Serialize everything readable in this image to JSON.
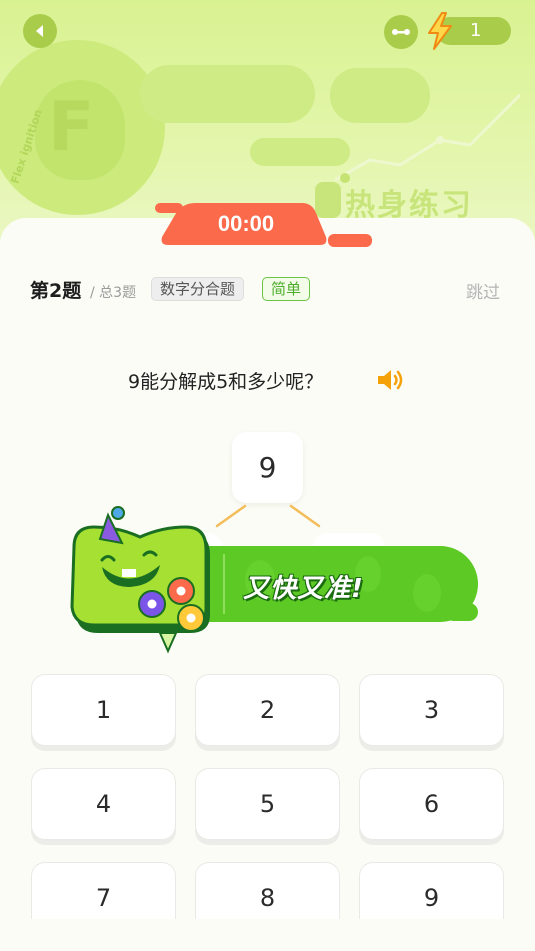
{
  "header": {
    "energy_count": "1",
    "banner_watermark": "Flex ignition",
    "logo_letter": "F",
    "watermark_title": "热身练习"
  },
  "timer": {
    "value": "00:00"
  },
  "question_meta": {
    "number": "第2题",
    "total": "/ 总3题",
    "type_tag": "数字分合题",
    "difficulty_tag": "简单",
    "skip_label": "跳过"
  },
  "question": {
    "text": "9能分解成5和多少呢？"
  },
  "tree": {
    "top_value": "9"
  },
  "feedback": {
    "banner_text": "又快又准!"
  },
  "keypad": {
    "keys": [
      "1",
      "2",
      "3",
      "4",
      "5",
      "6",
      "7",
      "8",
      "9"
    ]
  },
  "colors": {
    "accent_red": "#fb6a4a",
    "accent_green": "#5cc925",
    "hero_green": "#d9f291",
    "speaker_orange": "#f5a20a"
  }
}
